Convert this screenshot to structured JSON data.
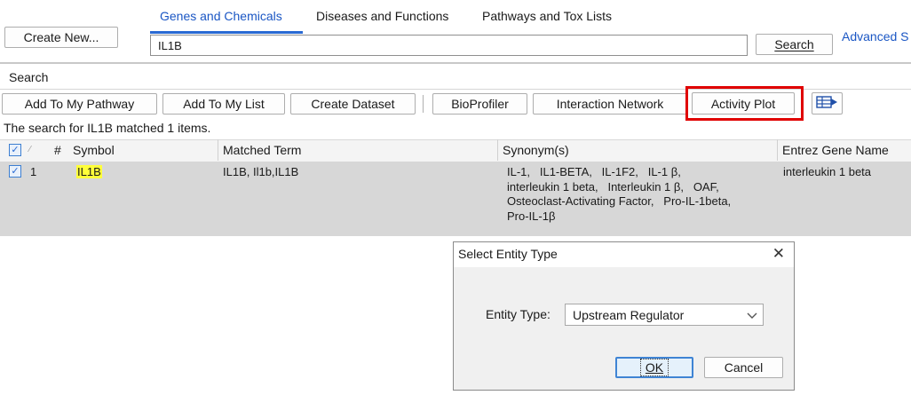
{
  "toolbar_top": {
    "create_new_label": "Create New...",
    "advanced_search_label": "Advanced S"
  },
  "tabs": [
    {
      "label": "Genes and Chemicals",
      "active": true
    },
    {
      "label": "Diseases and Functions",
      "active": false
    },
    {
      "label": "Pathways and Tox Lists",
      "active": false
    }
  ],
  "search": {
    "value": "IL1B",
    "button_label": "Search",
    "section_label": "Search"
  },
  "actions": {
    "add_to_pathway": "Add To My Pathway",
    "add_to_list": "Add To My List",
    "create_dataset": "Create Dataset",
    "bioprofiler": "BioProfiler",
    "interaction_network": "Interaction Network",
    "activity_plot": "Activity Plot",
    "highlight_color": "#e00000"
  },
  "results": {
    "summary": "The search for IL1B matched 1 items.",
    "columns": {
      "number": "#",
      "symbol": "Symbol",
      "matched_term": "Matched Term",
      "synonyms": "Synonym(s)",
      "entrez_gene_name": "Entrez Gene Name"
    },
    "rows": [
      {
        "number": "1",
        "symbol": "IL1B",
        "matched_term": "IL1B, Il1b,IL1B",
        "synonyms_lines": [
          "IL-1,   IL1-BETA,   IL-1F2,   IL-1 β,",
          "interleukin 1 beta,   Interleukin 1 β,   OAF,",
          "Osteoclast-Activating Factor,   Pro-IL-1beta,",
          "Pro-IL-1β"
        ],
        "entrez_gene_name": "interleukin 1 beta"
      }
    ]
  },
  "dialog": {
    "title": "Select Entity Type",
    "close_glyph": "✕",
    "entity_type_label": "Entity Type:",
    "entity_type_value": "Upstream Regulator",
    "ok_label": "OK",
    "cancel_label": "Cancel"
  }
}
